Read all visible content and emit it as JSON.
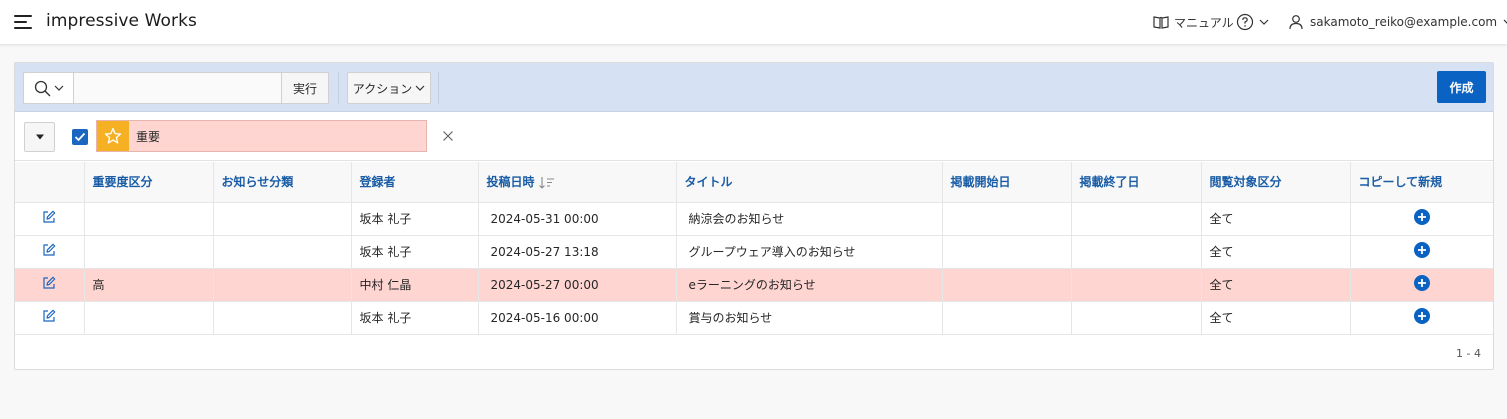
{
  "header": {
    "app_title": "impressive Works",
    "manual_label": "マニュアル",
    "user_email": "sakamoto_reiko@example.com",
    "icons": [
      "menu-icon",
      "book-icon",
      "help-icon",
      "user-icon",
      "chevron-down-icon"
    ]
  },
  "toolbar": {
    "search_value": "",
    "search_placeholder": "",
    "go_label": "実行",
    "actions_label": "アクション",
    "create_label": "作成"
  },
  "filter": {
    "checked": true,
    "label": "重要",
    "icon": "star-icon"
  },
  "table": {
    "columns": [
      "",
      "重要度区分",
      "お知らせ分類",
      "登録者",
      "投稿日時",
      "タイトル",
      "掲載開始日",
      "掲載終了日",
      "閲覧対象区分",
      "コピーして新規"
    ],
    "sort_column": "投稿日時",
    "sort_direction": "descending",
    "rows": [
      {
        "importance": "",
        "category": "",
        "registrant": "坂本 礼子",
        "posted": "2024-05-31 00:00",
        "title": "納涼会のお知らせ",
        "start": "",
        "end": "",
        "audience": "全て",
        "highlighted": false
      },
      {
        "importance": "",
        "category": "",
        "registrant": "坂本 礼子",
        "posted": "2024-05-27 13:18",
        "title": "グループウェア導入のお知らせ",
        "start": "",
        "end": "",
        "audience": "全て",
        "highlighted": false
      },
      {
        "importance": "高",
        "category": "",
        "registrant": "中村 仁晶",
        "posted": "2024-05-27 00:00",
        "title": "eラーニングのお知らせ",
        "start": "",
        "end": "",
        "audience": "全て",
        "highlighted": true
      },
      {
        "importance": "",
        "category": "",
        "registrant": "坂本 礼子",
        "posted": "2024-05-16 00:00",
        "title": "賞与のお知らせ",
        "start": "",
        "end": "",
        "audience": "全て",
        "highlighted": false
      }
    ]
  },
  "pagination": {
    "text": "1 - 4"
  },
  "colors": {
    "toolbar_bg": "#d6e2f3",
    "primary_button": "#0a62c2",
    "highlight_row": "#ffd5d2",
    "star_bg": "#f5b024",
    "header_link": "#1a5da6"
  }
}
